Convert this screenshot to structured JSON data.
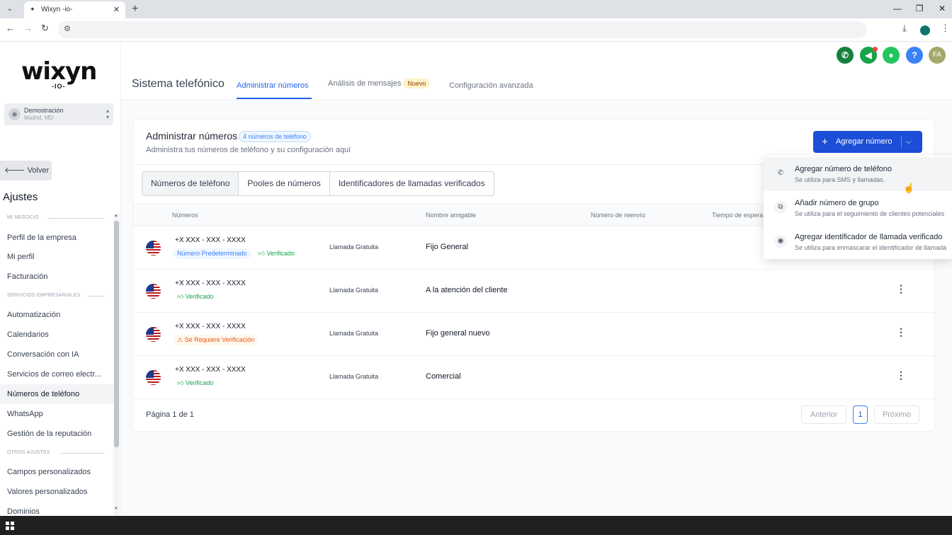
{
  "browser": {
    "tab_title": "Wixyn -io-",
    "tab_close": "✕",
    "new_tab": "+",
    "window_controls": [
      "—",
      "❐",
      "✕"
    ]
  },
  "brand": {
    "logo": "wixyn",
    "logo_sub": "-IO-"
  },
  "location": {
    "name": "Demostración",
    "city": "Madrid, MD"
  },
  "sidebar": {
    "back_label": "Volver",
    "heading": "Ajustes",
    "sections": [
      "MI NEGOCIO",
      "SERVICIOS EMPRESARIALES",
      "OTROS AJUSTES"
    ],
    "items": [
      "Perfil de la empresa",
      "Mi perfil",
      "Facturación",
      "Automatización",
      "Calendarios",
      "Conversación con IA",
      "Servicios de correo electr...",
      "Números de teléfono",
      "WhatsApp",
      "Gestión de la reputación",
      "Campos personalizados",
      "Valores personalizados",
      "Dominios"
    ]
  },
  "topbar": {
    "avatar_initials": "FA",
    "help": "?"
  },
  "subnav": {
    "title": "Sistema telefónico",
    "tabs": [
      "Administrar números",
      "Análisis de mensajes",
      "Configuración avanzada"
    ],
    "new_badge": "Nuevo"
  },
  "card": {
    "title": "Administrar números",
    "count_badge": "4 números de teléfono",
    "subtitle": "Administra tus números de teléfono y su configuración aquí",
    "add_button": "Agregar número",
    "segments": [
      "Números de teléfono",
      "Pooles de números",
      "Identificadores de llamadas verificados"
    ],
    "columns": [
      "Números",
      "Nombre amigable",
      "Número de reenvío",
      "Tiempo de espera"
    ],
    "rows": [
      {
        "number": "+X XXX - XXX - XXXX",
        "tag1": "Número Predeterminado",
        "tag2": "Verificado",
        "type": "Llamada Gratuita",
        "friendly": "Fijo General"
      },
      {
        "number": "+X XXX - XXX - XXXX",
        "tag1": "Verificado",
        "type": "Llamada Gratuita",
        "friendly": "A la atención del cliente"
      },
      {
        "number": "+X XXX - XXX - XXXX",
        "tag1": "Se Requiere Verificación",
        "type": "Llamada Gratuita",
        "friendly": "Fijo general nuevo"
      },
      {
        "number": "+X XXX - XXX - XXXX",
        "tag1": "Verificado",
        "type": "Llamada Gratuita",
        "friendly": "Comercial"
      }
    ],
    "pagination": {
      "label": "Página 1 de 1",
      "prev": "Anterior",
      "current": "1",
      "next": "Próximo"
    }
  },
  "dropdown": [
    {
      "title": "Agregar número de teléfono",
      "desc": "Se utiliza para SMS y llamadas."
    },
    {
      "title": "Añadir número de grupo",
      "desc": "Se utiliza para el seguimiento de clientes potenciales"
    },
    {
      "title": "Agregar identificador de llamada verificado",
      "desc": "Se utiliza para enmascarar el identificador de llamada"
    }
  ],
  "colors": {
    "primary": "#1d4ed8",
    "accent": "#2563eb",
    "green": "#16a34a",
    "orange": "#ea580c"
  }
}
